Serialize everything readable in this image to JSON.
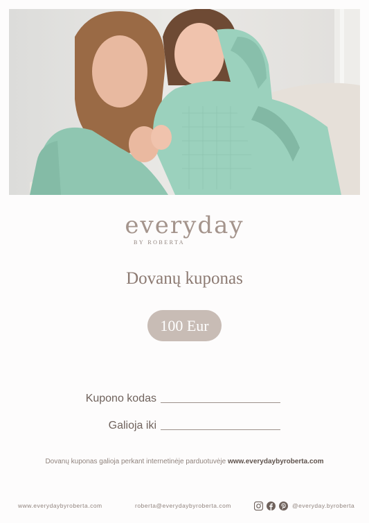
{
  "photo": {
    "subject": "mother-and-daughter-in-mint-robes"
  },
  "brand": {
    "name": "everyday",
    "sub": "BY ROBERTA"
  },
  "voucher": {
    "title": "Dovanų kuponas",
    "amount": "100 Eur"
  },
  "fields": {
    "code_label": "Kupono kodas",
    "valid_label": "Galioja iki"
  },
  "note": {
    "text": "Dovanų kuponas galioja perkant internetinėje parduotuvėje",
    "link": "www.everydaybyroberta.com"
  },
  "footer": {
    "website": "www.everydaybyroberta.com",
    "email": "roberta@everydaybyroberta.com",
    "handle": "@everyday.byroberta",
    "icons": [
      "instagram-icon",
      "facebook-icon",
      "pinterest-icon"
    ]
  },
  "colors": {
    "accent": "#c8bcb5",
    "text": "#6b5e58",
    "mint": "#93cbb7"
  }
}
